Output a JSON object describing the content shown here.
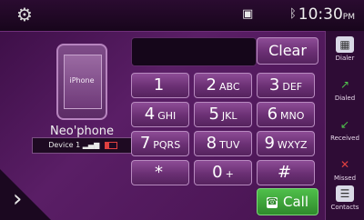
{
  "statusbar": {
    "settings_icon": "gear-icon",
    "monitor_icon": "screen-icon",
    "bluetooth_icon": "bluetooth-icon",
    "time": "10:30",
    "ampm": "PM"
  },
  "device": {
    "phone_label": "iPhone",
    "name": "Neo'phone",
    "info": "Device 1"
  },
  "dialpad": {
    "clear_label": "Clear",
    "call_label": "Call",
    "keys": [
      {
        "num": "1",
        "letters": ""
      },
      {
        "num": "2",
        "letters": "ABC"
      },
      {
        "num": "3",
        "letters": "DEF"
      },
      {
        "num": "4",
        "letters": "GHI"
      },
      {
        "num": "5",
        "letters": "JKL"
      },
      {
        "num": "6",
        "letters": "MNO"
      },
      {
        "num": "7",
        "letters": "PQRS"
      },
      {
        "num": "8",
        "letters": "TUV"
      },
      {
        "num": "9",
        "letters": "WXYZ"
      },
      {
        "num": "*",
        "letters": ""
      },
      {
        "num": "0",
        "letters": "+"
      },
      {
        "num": "#",
        "letters": ""
      }
    ]
  },
  "sidebar": {
    "items": [
      {
        "label": "Dialer",
        "icon": "dialer-icon"
      },
      {
        "label": "Dialed",
        "icon": "dialed-icon"
      },
      {
        "label": "Received",
        "icon": "received-icon"
      },
      {
        "label": "Missed",
        "icon": "missed-icon"
      },
      {
        "label": "Contacts",
        "icon": "contacts-icon"
      }
    ]
  },
  "colors": {
    "accent": "#6a2f73",
    "call_green": "#3aa43a",
    "missed_red": "#e04040"
  }
}
